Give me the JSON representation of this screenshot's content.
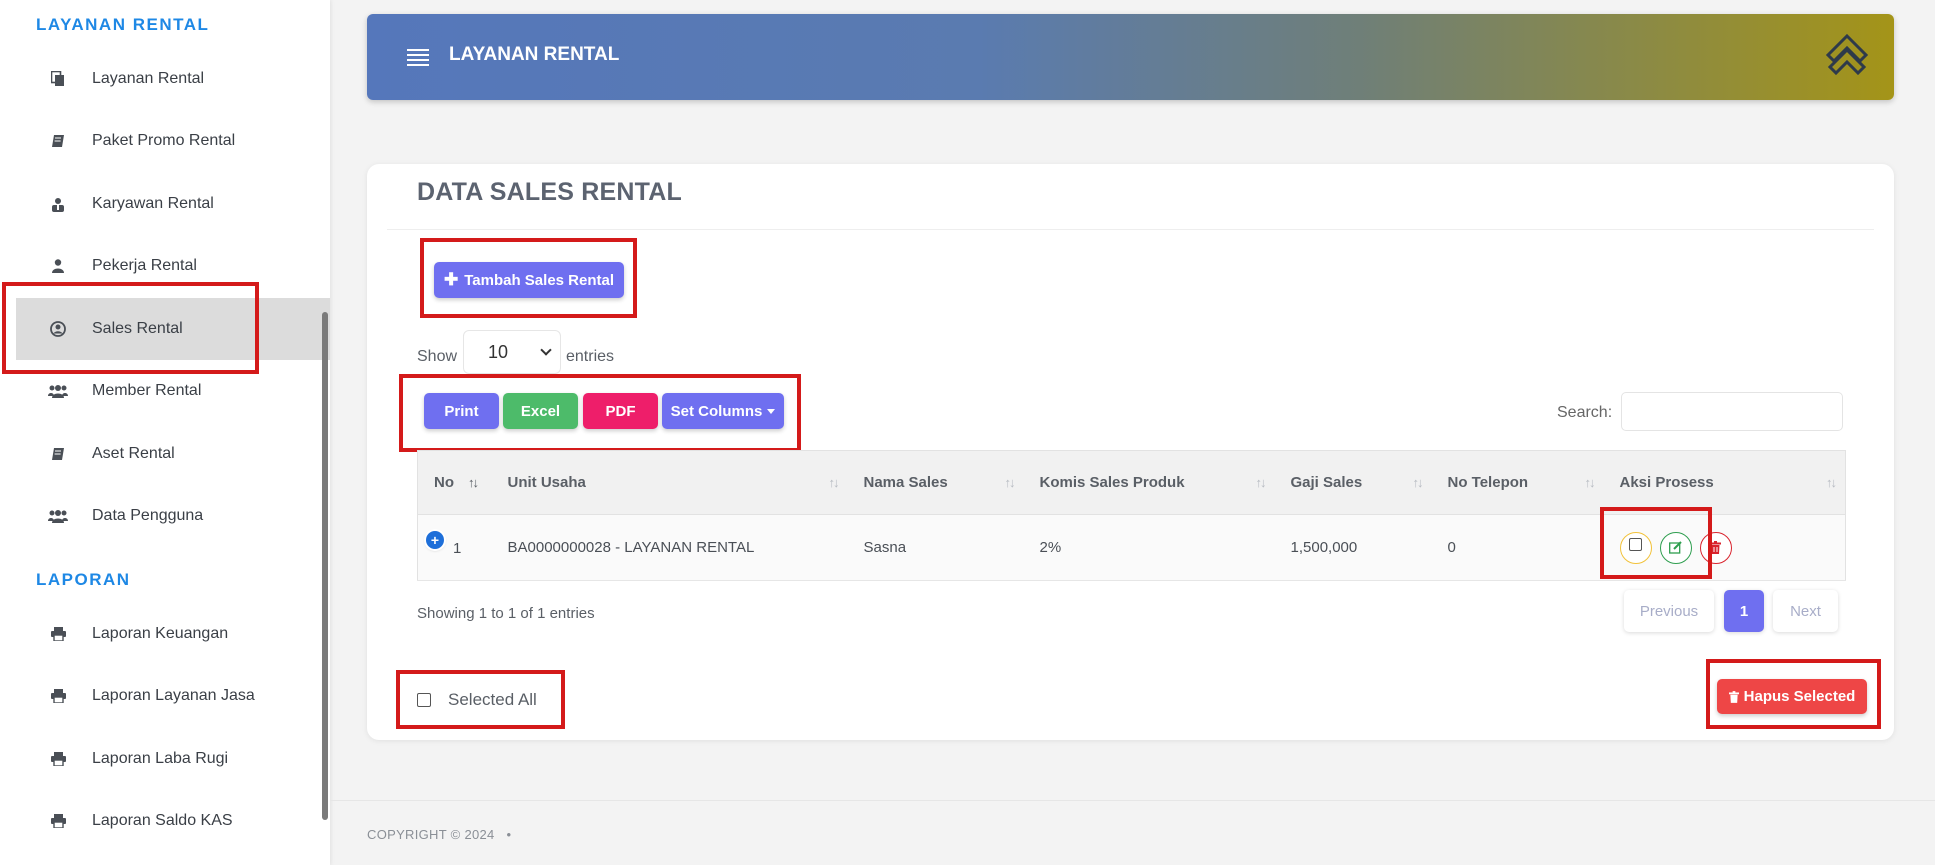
{
  "sidebar": {
    "section1": "LAYANAN RENTAL",
    "section2": "LAPORAN",
    "items": [
      {
        "label": "Layanan Rental",
        "icon": "copy-icon"
      },
      {
        "label": "Paket Promo Rental",
        "icon": "book-icon"
      },
      {
        "label": "Karyawan Rental",
        "icon": "user-tie-icon"
      },
      {
        "label": "Pekerja Rental",
        "icon": "user-icon"
      },
      {
        "label": "Sales Rental",
        "icon": "user-circle-icon"
      },
      {
        "label": "Member Rental",
        "icon": "users-icon"
      },
      {
        "label": "Aset Rental",
        "icon": "book-icon"
      },
      {
        "label": "Data Pengguna",
        "icon": "users-icon"
      }
    ],
    "reports": [
      {
        "label": "Laporan Keuangan",
        "icon": "print-icon"
      },
      {
        "label": "Laporan Layanan Jasa",
        "icon": "print-icon"
      },
      {
        "label": "Laporan Laba Rugi",
        "icon": "print-icon"
      },
      {
        "label": "Laporan Saldo KAS",
        "icon": "print-icon"
      }
    ],
    "active_item": "Sales Rental"
  },
  "header": {
    "title": "LAYANAN RENTAL"
  },
  "card": {
    "title": "DATA SALES RENTAL",
    "add_button": "Tambah Sales Rental",
    "show_label": "Show",
    "entries_value": "10",
    "entries_label": "entries",
    "export_buttons": {
      "print": "Print",
      "excel": "Excel",
      "pdf": "PDF",
      "columns": "Set Columns"
    },
    "search_label": "Search:",
    "search_value": ""
  },
  "table": {
    "columns": [
      "No",
      "Unit Usaha",
      "Nama Sales",
      "Komis Sales Produk",
      "Gaji Sales",
      "No Telepon",
      "Aksi Prosess"
    ],
    "rows": [
      {
        "no": "1",
        "unit_usaha": "BA0000000028 - LAYANAN RENTAL",
        "nama_sales": "Sasna",
        "komisi": "2%",
        "gaji": "1,500,000",
        "telepon": "0"
      }
    ]
  },
  "pagination": {
    "info": "Showing 1 to 1 of 1 entries",
    "previous": "Previous",
    "current": "1",
    "next": "Next"
  },
  "bulk": {
    "select_all": "Selected All",
    "delete_button": "Hapus Selected"
  },
  "footer": {
    "copyright": "COPYRIGHT © 2024"
  },
  "colors": {
    "primary": "#6f6ff0",
    "excel": "#4dbb6a",
    "pdf": "#ee1e6a",
    "danger": "#ee4646",
    "highlight": "#d41a1a"
  }
}
